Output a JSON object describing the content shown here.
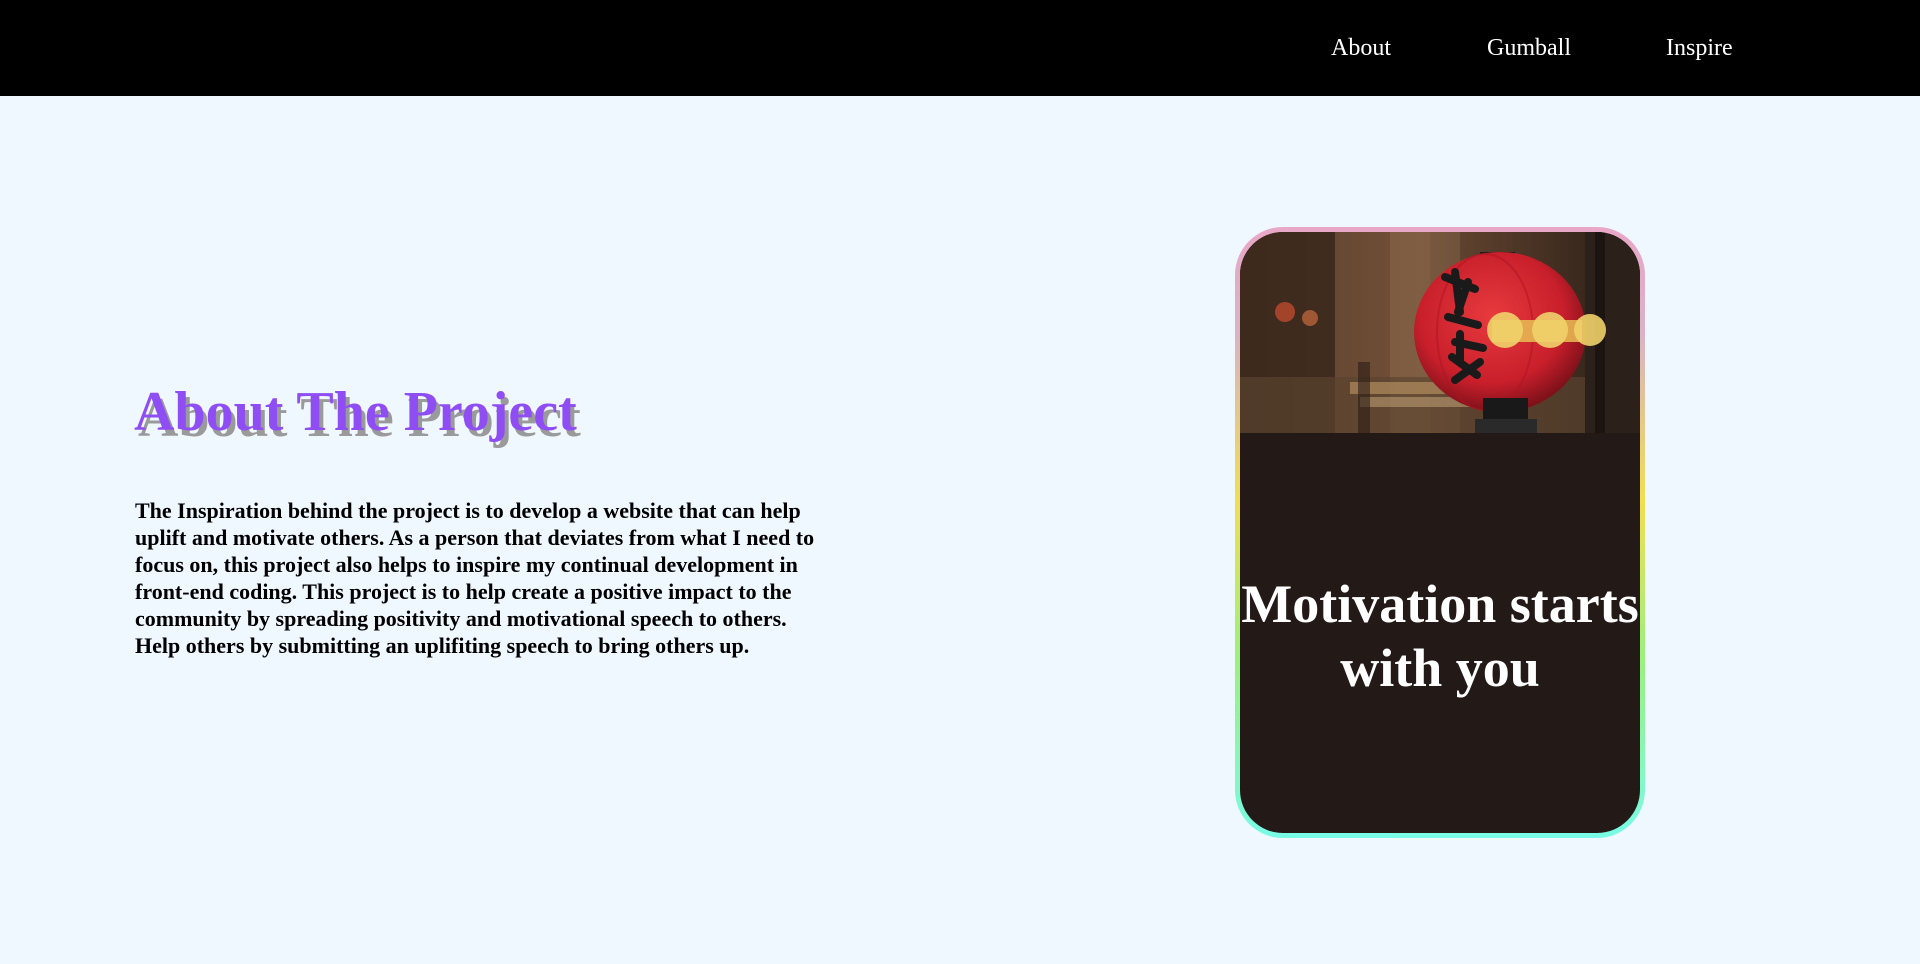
{
  "nav": {
    "items": [
      {
        "label": "About"
      },
      {
        "label": "Gumball"
      },
      {
        "label": "Inspire"
      }
    ]
  },
  "main": {
    "title": "About The Project",
    "body": "The Inspiration behind the project is to develop a website that can help uplift and motivate others. As a person that deviates from what I need to focus on, this project also helps to inspire my continual development in front-end coding. This project is to help create a positive impact to the community by spreading positivity and motivational speech to others. Help others by submitting an uplifiting speech to bring others up."
  },
  "card": {
    "text": "Motivation starts with you",
    "border_colors": [
      "#e9a7c8",
      "#f2de50",
      "#78fbe6"
    ],
    "background": "#231a18"
  },
  "colors": {
    "page_bg": "#f0f8ff",
    "navbar_bg": "#000000",
    "title": "#8f4df4"
  }
}
